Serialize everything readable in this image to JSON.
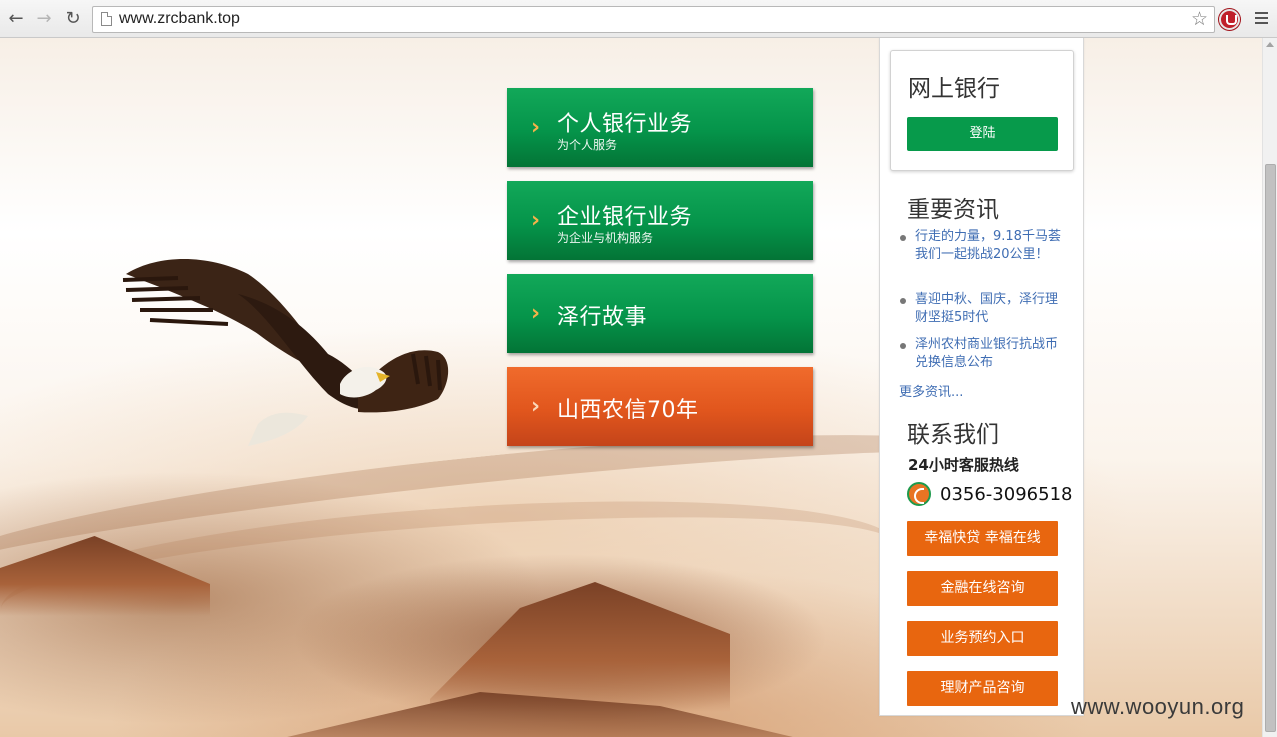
{
  "browser": {
    "url": "www.zrcbank.top"
  },
  "menu": [
    {
      "title": "个人银行业务",
      "subtitle": "为个人服务"
    },
    {
      "title": "企业银行业务",
      "subtitle": "为企业与机构服务"
    },
    {
      "title": "泽行故事",
      "subtitle": ""
    },
    {
      "title": "山西农信70年",
      "subtitle": ""
    }
  ],
  "sidebar": {
    "online_banking": {
      "title": "网上银行",
      "login_label": "登陆"
    },
    "news": {
      "title": "重要资讯",
      "items": [
        "行走的力量，9.18千马荟我们一起挑战20公里！",
        "喜迎中秋、国庆，泽行理财坚挺5时代",
        "泽州农村商业银行抗战币兑换信息公布"
      ],
      "more": "更多资讯..."
    },
    "contact": {
      "title": "联系我们",
      "hotline_label": "24小时客服热线",
      "phone": "0356-3096518",
      "buttons": [
        "幸福快贷 幸福在线",
        "金融在线咨询",
        "业务预约入口",
        "理财产品咨询"
      ]
    }
  },
  "watermark": "www.wooyun.org",
  "colors": {
    "green": "#079a4b",
    "orange": "#e8660f",
    "link": "#3f6db3"
  }
}
